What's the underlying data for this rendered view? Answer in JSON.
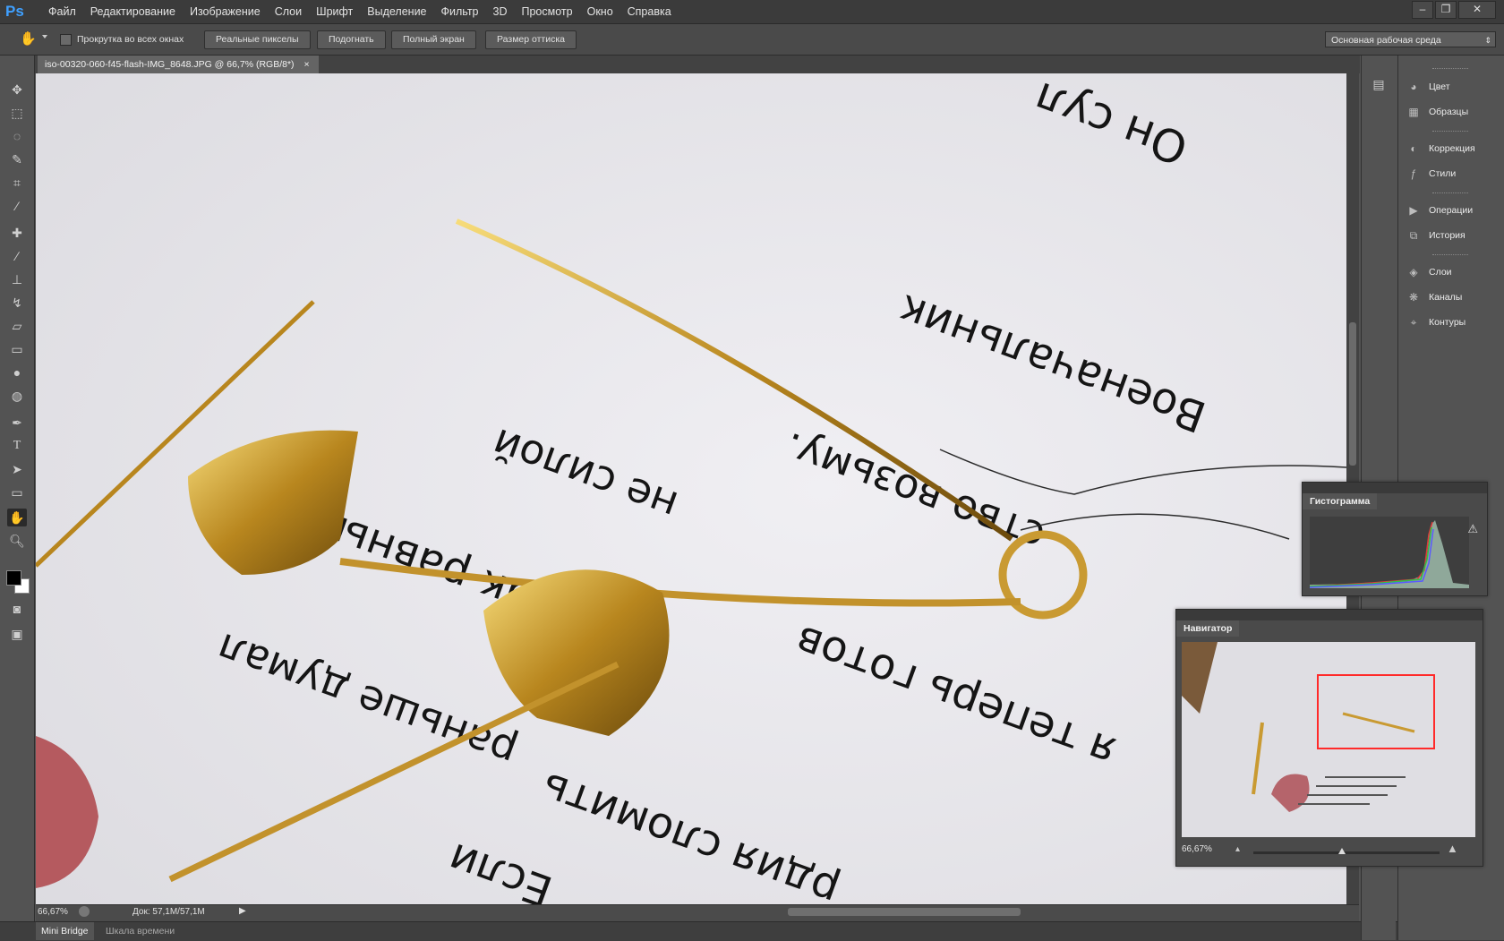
{
  "app": {
    "logo": "Ps"
  },
  "menu": [
    "Файл",
    "Редактирование",
    "Изображение",
    "Слои",
    "Шрифт",
    "Выделение",
    "Фильтр",
    "3D",
    "Просмотр",
    "Окно",
    "Справка"
  ],
  "window_controls": {
    "minimize": "‒",
    "restore": "❐",
    "close": "✕"
  },
  "options": {
    "scroll_all_label": "Прокрутка во всех окнах",
    "scroll_all_checked": false,
    "buttons": [
      "Реальные пикселы",
      "Подогнать",
      "Полный экран",
      "Размер оттиска"
    ],
    "workspace": "Основная рабочая среда"
  },
  "document": {
    "tab_title": "iso-00320-060-f45-flash-IMG_8648.JPG @ 66,7% (RGB/8*)",
    "tab_close": "×",
    "image_text": {
      "line1": "Он сул",
      "line2": "Военачальник",
      "line3": "ство возьму.",
      "line4": "не силой",
      "line5": "я теперь готов",
      "line6": "но, как равный",
      "line7": "рдия сломить",
      "line8": "раньше думал",
      "line9": "Если"
    }
  },
  "status": {
    "zoom": "66,67%",
    "doc": "Док: 57,1M/57,1M"
  },
  "bottom_tabs": [
    "Mini Bridge",
    "Шкала времени"
  ],
  "dock": {
    "groups": [
      [
        {
          "label": "Цвет",
          "icon": "palette-icon"
        },
        {
          "label": "Образцы",
          "icon": "grid-icon"
        }
      ],
      [
        {
          "label": "Коррекция",
          "icon": "adjust-icon"
        },
        {
          "label": "Стили",
          "icon": "fx-icon"
        }
      ],
      [
        {
          "label": "Операции",
          "icon": "play-icon"
        },
        {
          "label": "История",
          "icon": "history-icon"
        }
      ],
      [
        {
          "label": "Слои",
          "icon": "layers-icon"
        },
        {
          "label": "Каналы",
          "icon": "channels-icon"
        },
        {
          "label": "Контуры",
          "icon": "paths-icon"
        }
      ]
    ]
  },
  "histogram": {
    "title": "Гистограмма",
    "warning": "⚠"
  },
  "navigator": {
    "title": "Навигатор",
    "zoom": "66,67%",
    "slider_position": 0.48
  },
  "colors": {
    "foreground": "#000000",
    "background": "#ffffff",
    "accent": "#3fa0ff",
    "nav_frame": "#ff2a2a"
  }
}
